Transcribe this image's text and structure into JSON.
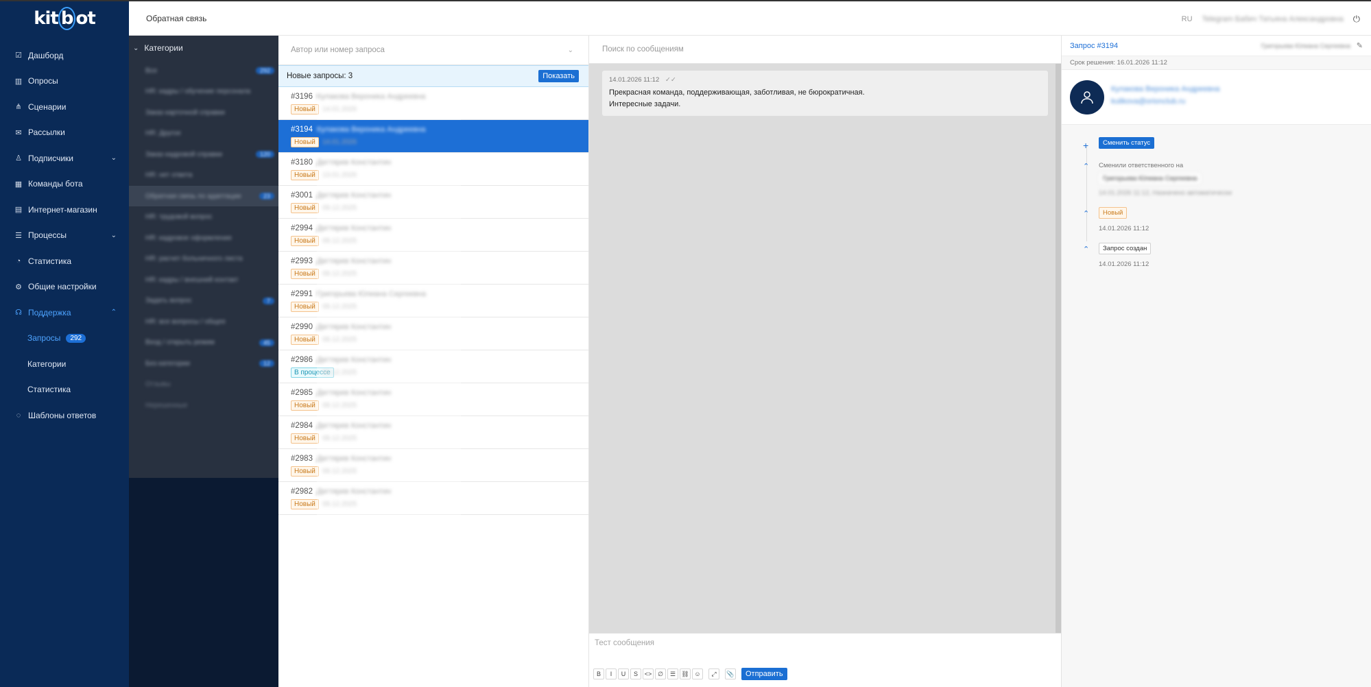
{
  "app": {
    "logo": "kitbot",
    "header_title": "Обратная связь",
    "lang": "RU",
    "user_blurred": "Telegram   Бабич Татьяна Александровна"
  },
  "nav": {
    "items": [
      {
        "label": "Дашборд",
        "icon": "dashboard-icon"
      },
      {
        "label": "Опросы",
        "icon": "chart-icon"
      },
      {
        "label": "Сценарии",
        "icon": "scenario-icon"
      },
      {
        "label": "Рассылки",
        "icon": "mail-icon"
      },
      {
        "label": "Подписчики",
        "icon": "subscribers-icon"
      },
      {
        "label": "Команды бота",
        "icon": "grid-icon"
      },
      {
        "label": "Интернет-магазин",
        "icon": "shop-icon"
      },
      {
        "label": "Процессы",
        "icon": "list-icon"
      },
      {
        "label": "Статистика",
        "icon": "pie-icon"
      },
      {
        "label": "Общие настройки",
        "icon": "gear-icon"
      },
      {
        "label": "Поддержка",
        "icon": "headset-icon"
      }
    ],
    "support_sub": [
      {
        "label": "Запросы",
        "badge": "292"
      },
      {
        "label": "Категории"
      },
      {
        "label": "Статистика"
      }
    ],
    "templates": "Шаблоны ответов"
  },
  "categories": {
    "title": "Категории",
    "rows": [
      {
        "label": "Все",
        "count": "292"
      },
      {
        "label": "HR: кадры / обучение персонала",
        "count": ""
      },
      {
        "label": "Заказ карточной справки",
        "count": ""
      },
      {
        "label": "HR: Другое",
        "count": ""
      },
      {
        "label": "Заказ кадровой справки",
        "count": "120"
      },
      {
        "label": "HR: нет ответа",
        "count": ""
      },
      {
        "label": "Обратная связь по адаптации",
        "count": "23"
      },
      {
        "label": "HR: трудовой вопрос",
        "count": ""
      },
      {
        "label": "HR: кадровое оформление",
        "count": ""
      },
      {
        "label": "HR: расчет больничного листа",
        "count": ""
      },
      {
        "label": "HR: кадры / внешний контакт",
        "count": ""
      },
      {
        "label": "Задать вопрос",
        "count": "7"
      },
      {
        "label": "HR: все вопросы / общее",
        "count": ""
      },
      {
        "label": "Вход / открыть режим",
        "count": "45"
      },
      {
        "label": "Без категории",
        "count": "12"
      },
      {
        "label": "Отзывы",
        "count": ""
      },
      {
        "label": "Нерешенные",
        "count": ""
      }
    ]
  },
  "requests": {
    "search_placeholder": "Автор или номер запроса",
    "new_banner": "Новые запросы: 3",
    "show_button": "Показать",
    "rows": [
      {
        "num": "#3196",
        "author": "Кулакова Вероника Андреевна",
        "status": "Новый",
        "date": "14.01.2026",
        "selected": false
      },
      {
        "num": "#3194",
        "author": "Кулакова Вероника Андреевна",
        "status": "Новый",
        "date": "14.01.2026",
        "selected": true
      },
      {
        "num": "#3180",
        "author": "Дегтярев Константин",
        "status": "Новый",
        "date": "13.01.2026",
        "selected": false
      },
      {
        "num": "#3001",
        "author": "Дегтярев Константин",
        "status": "Новый",
        "date": "09.12.2025",
        "selected": false
      },
      {
        "num": "#2994",
        "author": "Дегтярев Константин",
        "status": "Новый",
        "date": "08.12.2025",
        "selected": false
      },
      {
        "num": "#2993",
        "author": "Дегтярев Константин",
        "status": "Новый",
        "date": "08.12.2025",
        "selected": false
      },
      {
        "num": "#2991",
        "author": "Григорьева Юлиана Сергеевна",
        "status": "Новый",
        "date": "08.12.2025",
        "selected": false
      },
      {
        "num": "#2990",
        "author": "Дегтярев Константин",
        "status": "Новый",
        "date": "08.12.2025",
        "selected": false
      },
      {
        "num": "#2986",
        "author": "Дегтярев Константин",
        "status": "В процессе",
        "date": "08.12.2025",
        "selected": false
      },
      {
        "num": "#2985",
        "author": "Дегтярев Константин",
        "status": "Новый",
        "date": "08.12.2025",
        "selected": false
      },
      {
        "num": "#2984",
        "author": "Дегтярев Константин",
        "status": "Новый",
        "date": "08.12.2025",
        "selected": false
      },
      {
        "num": "#2983",
        "author": "Дегтярев Константин",
        "status": "Новый",
        "date": "08.12.2025",
        "selected": false
      },
      {
        "num": "#2982",
        "author": "Дегтярев Константин",
        "status": "Новый",
        "date": "08.12.2025",
        "selected": false
      }
    ]
  },
  "chat": {
    "search_placeholder": "Поиск по сообщениям",
    "message": {
      "time": "14.01.2026 11:12",
      "line1": "Прекрасная команда, поддерживающая, заботливая, не бюрократичная.",
      "line2": "Интересные задачи."
    },
    "compose_placeholder": "Тест сообщения",
    "tools": [
      "B",
      "I",
      "U",
      "S",
      "<>",
      "∅",
      "☰",
      "⛓",
      "☺",
      "⤢",
      "📎"
    ],
    "send": "Отправить"
  },
  "detail": {
    "title": "Запрос #3194",
    "responsible": "Григорьева Юлиана Сергеевна",
    "deadline": "Срок решения: 16.01.2026 11:12",
    "user_name": "Кулакова Вероника Андреевна",
    "user_mail": "kulikova@orionclub.ru",
    "change_status": "Сменить статус",
    "changed_resp": "Сменили ответственного на",
    "resp_chip": "Григорьева Юлиана Сергеевна",
    "resp_meta": "14.01.2026 11:12, Назначено автоматически",
    "status_chip": "Новый",
    "status_time": "14.01.2026 11:12",
    "created_chip": "Запрос создан",
    "created_time": "14.01.2026 11:12"
  }
}
